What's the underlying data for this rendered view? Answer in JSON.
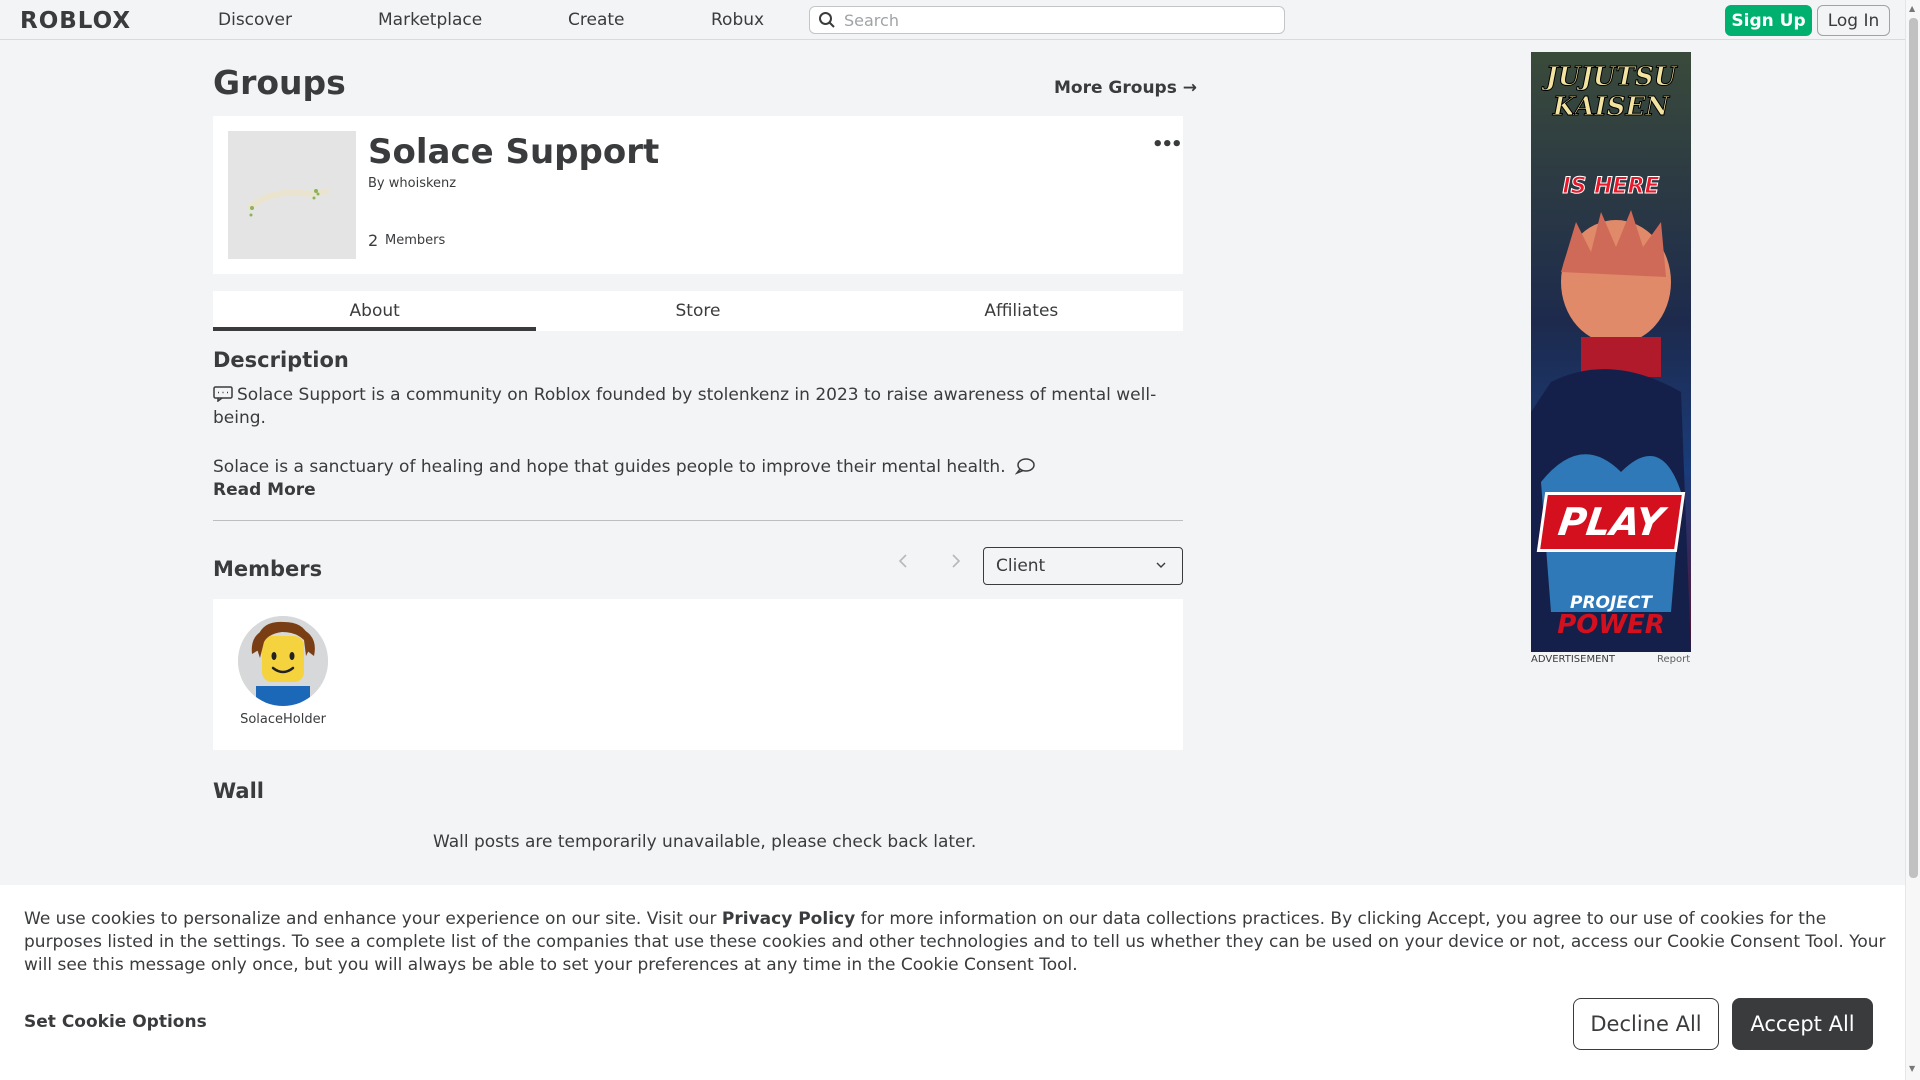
{
  "nav": {
    "logo": "ROBLOX",
    "links": [
      "Discover",
      "Marketplace",
      "Create",
      "Robux"
    ],
    "search_placeholder": "Search",
    "signup_label": "Sign Up",
    "login_label": "Log In"
  },
  "page": {
    "title": "Groups",
    "more_groups": "More Groups →"
  },
  "group": {
    "name": "Solace Support",
    "by_prefix": "By",
    "owner": "whoiskenz",
    "members_count": "2",
    "members_label": "Members",
    "more_menu": "•••"
  },
  "tabs": [
    "About",
    "Store",
    "Affiliates"
  ],
  "about": {
    "description_title": "Description",
    "description_line1": "Solace Support is a community on Roblox founded by stolenkenz in 2023 to raise awareness of mental well-being.",
    "description_line2": "Solace is a sanctuary of healing and hope that guides people to improve their mental health.",
    "read_more": "Read More",
    "members_title": "Members",
    "role_selected": "Client",
    "members": [
      {
        "name": "SolaceHolder"
      }
    ],
    "wall_title": "Wall",
    "wall_message": "Wall posts are temporarily unavailable, please check back later."
  },
  "ad": {
    "label": "ADVERTISEMENT",
    "report": "Report",
    "headline1": "JUJUTSU",
    "headline2": "KAISEN",
    "headline3": "IS HERE",
    "cta": "PLAY",
    "brand1": "PROJECT",
    "brand2": "POWER"
  },
  "cookie": {
    "text_before": "We use cookies to personalize and enhance your experience on our site. Visit our",
    "privacy_policy": "Privacy Policy",
    "text_after": "for more information on our data collections practices. By clicking Accept, you agree to our use of cookies for the purposes listed in the settings. To see a complete list of the companies that use these cookies and other technologies and to tell us whether they can be used on your device or not, access our Cookie Consent Tool. Your will see this message only once, but you will always be able to set your preferences at any time in the Cookie Consent Tool.",
    "set_options": "Set Cookie Options",
    "decline": "Decline All",
    "accept": "Accept All"
  },
  "colors": {
    "signup": "#00b06f",
    "text": "#393b3d",
    "background": "#f2f4f5"
  }
}
